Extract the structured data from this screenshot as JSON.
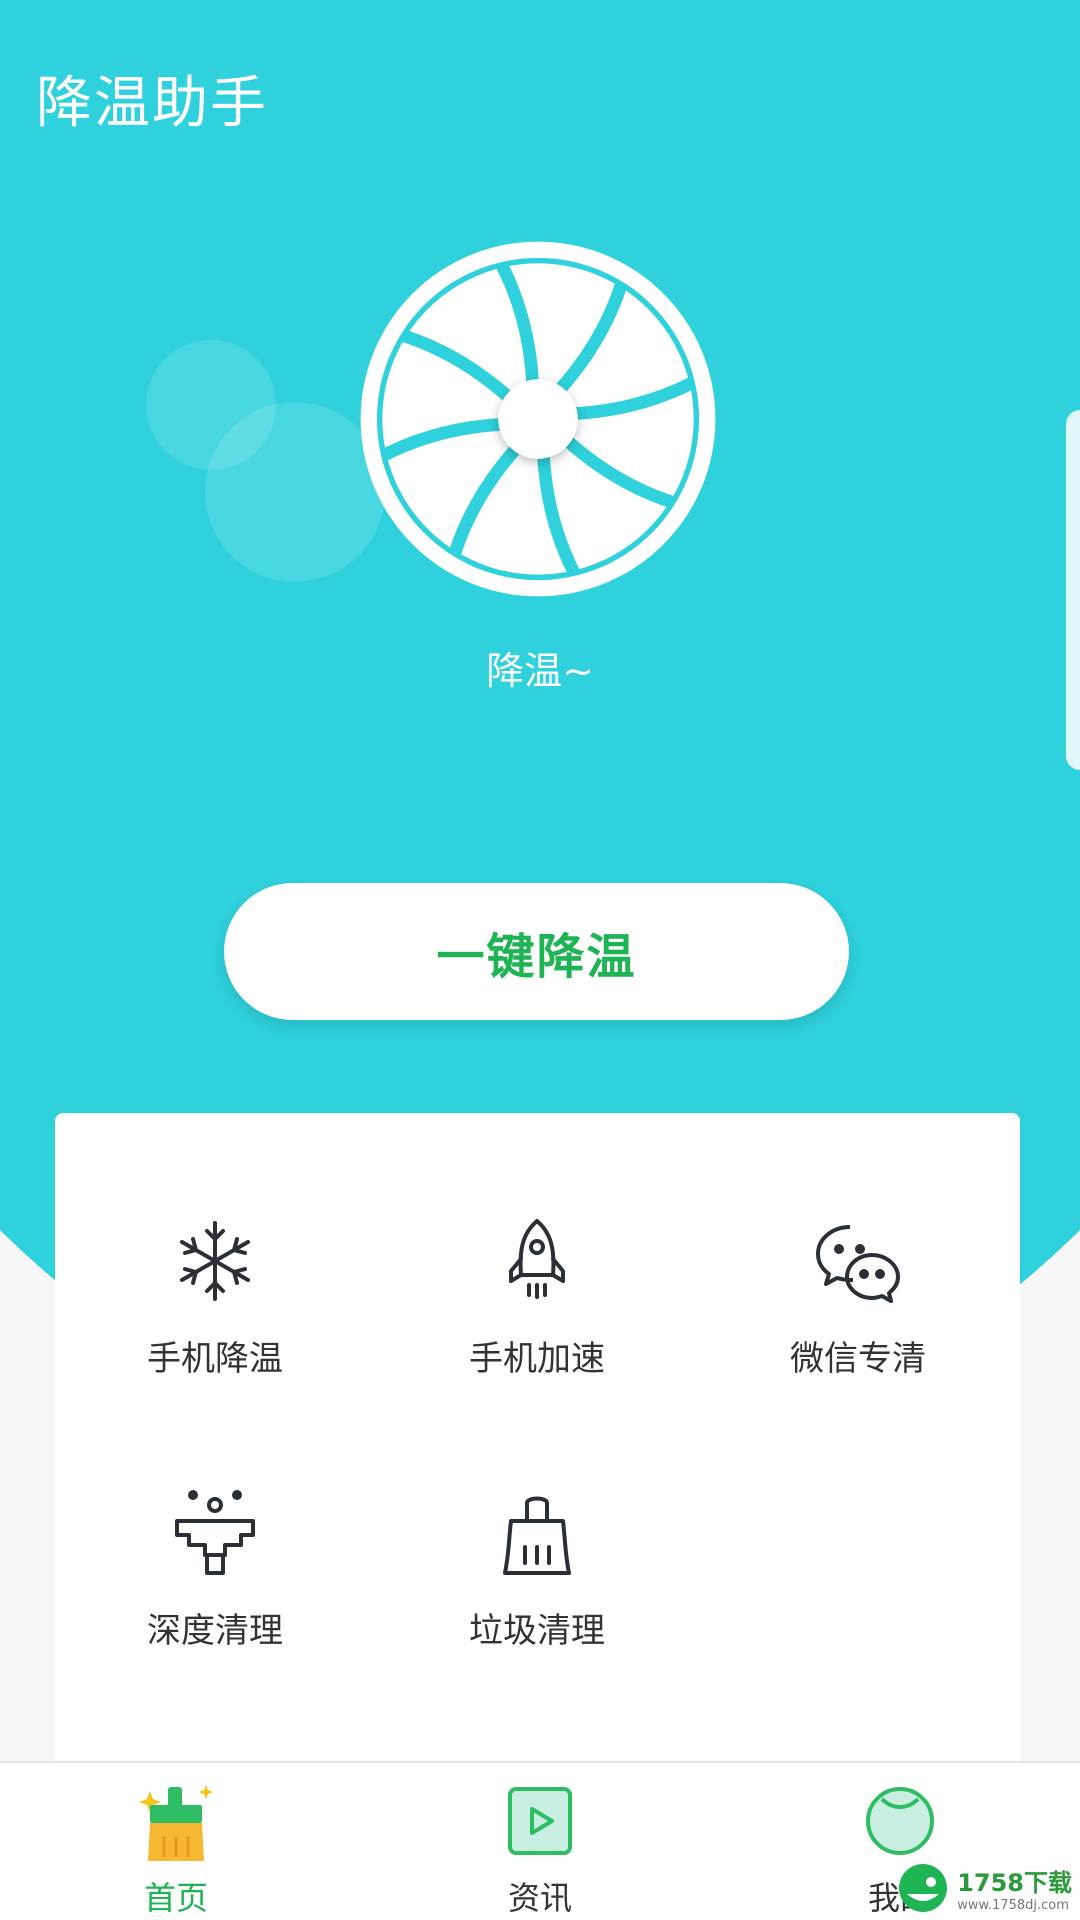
{
  "header": {
    "title": "降温助手"
  },
  "hero": {
    "status": "降温~"
  },
  "primary_action": {
    "label": "一键降温"
  },
  "tools": [
    {
      "label": "手机降温",
      "icon": "snowflake-icon"
    },
    {
      "label": "手机加速",
      "icon": "rocket-icon"
    },
    {
      "label": "微信专清",
      "icon": "wechat-icon"
    },
    {
      "label": "深度清理",
      "icon": "deep-clean-icon"
    },
    {
      "label": "垃圾清理",
      "icon": "broom-icon"
    }
  ],
  "nav": [
    {
      "label": "首页",
      "icon": "home-broom-icon",
      "active": true
    },
    {
      "label": "资讯",
      "icon": "video-icon",
      "active": false
    },
    {
      "label": "我的",
      "icon": "profile-icon",
      "active": false
    }
  ],
  "watermark": {
    "text": "1758下载",
    "url": "www.1758dj.com"
  },
  "colors": {
    "primary": "#2ed1dc",
    "accent": "#1eb454"
  }
}
